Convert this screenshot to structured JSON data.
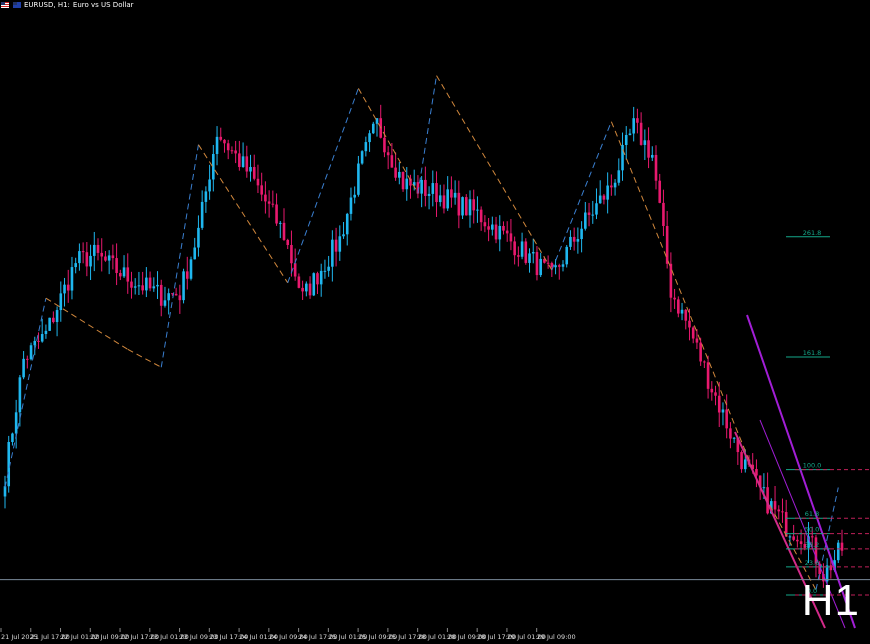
{
  "header": {
    "symbol": "EURUSD, H1:",
    "description": "Euro vs US Dollar"
  },
  "timeframe_label": "H1",
  "colors": {
    "bull": "#1fb7ef",
    "bear": "#e8196e",
    "zigzag_up": "#3a7fd0",
    "zigzag_down": "#d0873c",
    "fib": "#14a88a",
    "channel_purple": "#a21ed6",
    "channel_pink": "#d42a8a",
    "level_lines": "#c0215a",
    "bid_line": "#7a8a9a"
  },
  "chart_data": {
    "type": "candlestick",
    "symbol": "EURUSD",
    "timeframe": "H1",
    "x_tick_labels": [
      "21 Jul 2025",
      "21 Jul 17:00",
      "22 Jul 01:00",
      "22 Jul 09:00",
      "22 Jul 17:00",
      "23 Jul 01:00",
      "23 Jul 09:00",
      "23 Jul 17:00",
      "24 Jul 01:00",
      "24 Jul 09:00",
      "24 Jul 17:00",
      "25 Jul 01:00",
      "25 Jul 09:00",
      "25 Jul 17:00",
      "28 Jul 01:00",
      "28 Jul 09:00",
      "28 Jul 17:00",
      "29 Jul 01:00",
      "29 Jul 09:00"
    ],
    "bars_per_tick": 8,
    "price_points": [
      [
        0,
        1.1635
      ],
      [
        5,
        1.168
      ],
      [
        11,
        1.169
      ],
      [
        19,
        1.1718
      ],
      [
        24,
        1.1721
      ],
      [
        33,
        1.1712
      ],
      [
        42,
        1.1705
      ],
      [
        47,
        1.1706
      ],
      [
        52,
        1.173
      ],
      [
        57,
        1.1769
      ],
      [
        66,
        1.1752
      ],
      [
        75,
        1.1729
      ],
      [
        80,
        1.1704
      ],
      [
        90,
        1.1727
      ],
      [
        96,
        1.1758
      ],
      [
        100,
        1.1772
      ],
      [
        107,
        1.1749
      ],
      [
        116,
        1.1745
      ],
      [
        127,
        1.1737
      ],
      [
        137,
        1.1725
      ],
      [
        147,
        1.1712
      ],
      [
        155,
        1.1732
      ],
      [
        163,
        1.1748
      ],
      [
        169,
        1.1771
      ],
      [
        174,
        1.176
      ],
      [
        179,
        1.1707
      ],
      [
        184,
        1.1692
      ],
      [
        190,
        1.1669
      ],
      [
        198,
        1.1641
      ],
      [
        204,
        1.1626
      ],
      [
        210,
        1.1615
      ],
      [
        216,
        1.161
      ],
      [
        220,
        1.1596
      ],
      [
        225,
        1.1606
      ]
    ],
    "zigzag_points": [
      [
        0,
        1.163
      ],
      [
        11,
        1.1704
      ],
      [
        33,
        1.1684
      ],
      [
        42,
        1.1677
      ],
      [
        52,
        1.1764
      ],
      [
        76,
        1.171
      ],
      [
        95,
        1.1786
      ],
      [
        111,
        1.1745
      ],
      [
        116,
        1.1791
      ],
      [
        147,
        1.1715
      ],
      [
        163,
        1.1773
      ],
      [
        203,
        1.163
      ],
      [
        218,
        1.159
      ],
      [
        224,
        1.163
      ]
    ],
    "fibonacci": {
      "levels": [
        "261.8",
        "161.8",
        "100.0",
        "61.8",
        "50.0",
        "38.2",
        "23.6",
        "0.0"
      ],
      "prices": [
        1.1728,
        1.1681,
        1.1637,
        1.1618,
        1.1612,
        1.1606,
        1.1599,
        1.1588
      ]
    },
    "price_range": [
      1.1579,
      1.1801
    ],
    "current_bid": 1.1594
  }
}
